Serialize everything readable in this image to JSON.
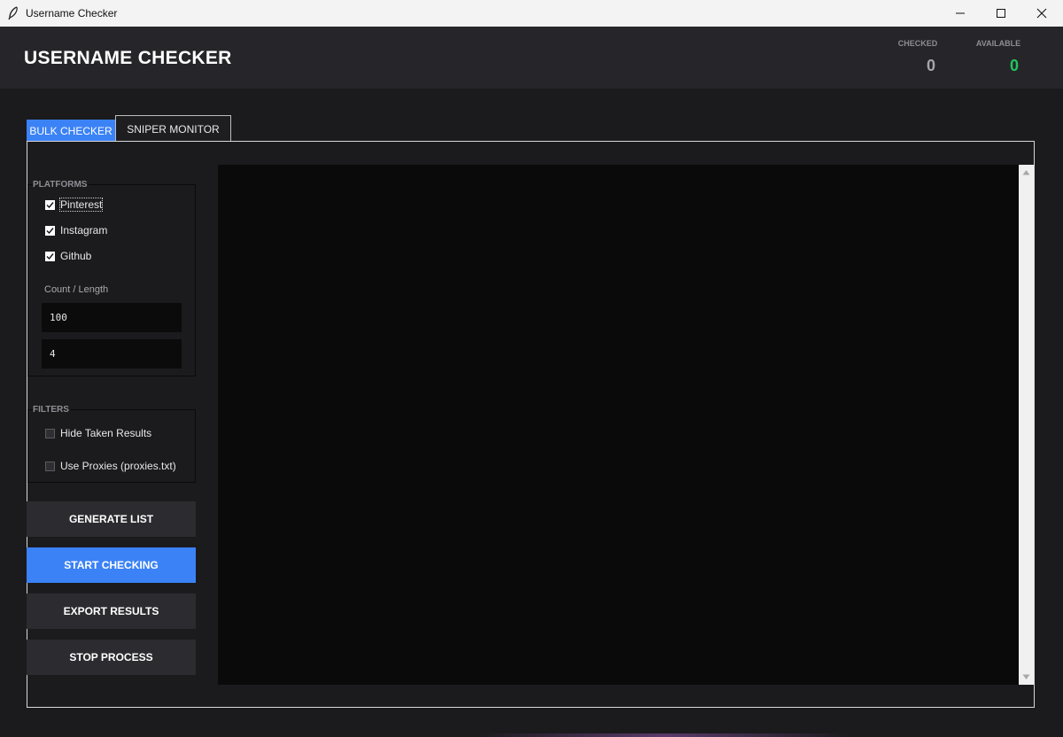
{
  "window": {
    "title": "Username Checker",
    "icons": {
      "app": "feather-icon",
      "minimize": "minimize-icon",
      "maximize": "maximize-icon",
      "close": "close-icon"
    }
  },
  "header": {
    "title": "USERNAME CHECKER",
    "stats": [
      {
        "label": "CHECKED",
        "value": "0",
        "color": "#a6a6ab"
      },
      {
        "label": "AVAILABLE",
        "value": "0",
        "color": "#22c55e"
      }
    ]
  },
  "tabs": [
    {
      "label": "BULK CHECKER",
      "active": true
    },
    {
      "label": "SNIPER MONITOR",
      "active": false
    }
  ],
  "platforms": {
    "label": "PLATFORMS",
    "items": [
      {
        "label": "Pinterest",
        "checked": true
      },
      {
        "label": "Instagram",
        "checked": true
      },
      {
        "label": "Github",
        "checked": true
      }
    ],
    "count_length_label": "Count / Length",
    "count_value": "100",
    "length_value": "4"
  },
  "filters": {
    "label": "FILTERS",
    "items": [
      {
        "label": "Hide Taken Results",
        "checked": false
      },
      {
        "label": "Use Proxies (proxies.txt)",
        "checked": false
      }
    ]
  },
  "actions": {
    "generate": "GENERATE LIST",
    "start": "START CHECKING",
    "export": "EXPORT RESULTS",
    "stop": "STOP PROCESS"
  },
  "colors": {
    "accent": "#3b82f6",
    "available": "#22c55e",
    "header_bg": "#26262a",
    "body_bg": "#1b1b1d",
    "output_bg": "#0a0a0b"
  }
}
